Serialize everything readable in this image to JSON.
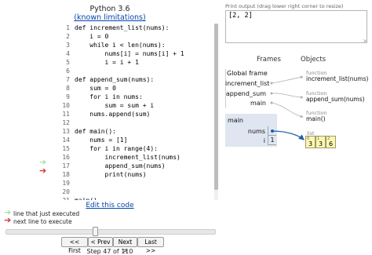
{
  "header": {
    "title": "Python 3.6",
    "link_text": "(known limitations)"
  },
  "code": {
    "lines": [
      {
        "n": "1",
        "text": "def increment_list(nums):",
        "marker": ""
      },
      {
        "n": "2",
        "text": "    i = 0",
        "marker": ""
      },
      {
        "n": "3",
        "text": "    while i < len(nums):",
        "marker": ""
      },
      {
        "n": "4",
        "text": "        nums[i] = nums[i] + 1",
        "marker": ""
      },
      {
        "n": "5",
        "text": "        i = i + 1",
        "marker": ""
      },
      {
        "n": "6",
        "text": "",
        "marker": ""
      },
      {
        "n": "7",
        "text": "def append_sum(nums):",
        "marker": ""
      },
      {
        "n": "8",
        "text": "    sum = 0",
        "marker": ""
      },
      {
        "n": "9",
        "text": "    for i in nums:",
        "marker": ""
      },
      {
        "n": "10",
        "text": "        sum = sum + i",
        "marker": ""
      },
      {
        "n": "11",
        "text": "    nums.append(sum)",
        "marker": ""
      },
      {
        "n": "12",
        "text": "",
        "marker": ""
      },
      {
        "n": "13",
        "text": "def main():",
        "marker": ""
      },
      {
        "n": "14",
        "text": "    nums = [1]",
        "marker": ""
      },
      {
        "n": "15",
        "text": "    for i in range(4):",
        "marker": ""
      },
      {
        "n": "16",
        "text": "        increment_list(nums)",
        "marker": ""
      },
      {
        "n": "17",
        "text": "        append_sum(nums)",
        "marker": "last"
      },
      {
        "n": "18",
        "text": "        print(nums)",
        "marker": "next"
      },
      {
        "n": "19",
        "text": "",
        "marker": ""
      },
      {
        "n": "20",
        "text": "",
        "marker": ""
      },
      {
        "n": "21",
        "text": "main()",
        "marker": ""
      }
    ]
  },
  "edit_link": "Edit this code",
  "legend": {
    "last_label": "line that just executed",
    "next_label": "next line to execute",
    "last_color": "#a6e3a1",
    "next_color": "#d32f2f"
  },
  "controls": {
    "first": "<< First",
    "prev": "< Prev",
    "next": "Next >",
    "last": "Last >>",
    "step_text": "Step 47 of 110",
    "progress": 0.427
  },
  "output": {
    "label": "Print output (drag lower right corner to resize)",
    "text": "[2, 2]"
  },
  "viz": {
    "frames_header": "Frames",
    "objects_header": "Objects",
    "global_frame": {
      "title": "Global frame",
      "vars": [
        "increment_list",
        "append_sum",
        "main"
      ]
    },
    "main_frame": {
      "title": "main",
      "vars": [
        {
          "name": "nums"
        },
        {
          "name": "i",
          "value": "1"
        }
      ]
    },
    "objects": [
      {
        "kind": "function",
        "label": "increment_list(nums)"
      },
      {
        "kind": "function",
        "label": "append_sum(nums)"
      },
      {
        "kind": "function",
        "label": "main()"
      }
    ],
    "list": {
      "kind": "list",
      "indices": [
        "0",
        "1",
        "2"
      ],
      "values": [
        "3",
        "3",
        "6"
      ]
    }
  }
}
